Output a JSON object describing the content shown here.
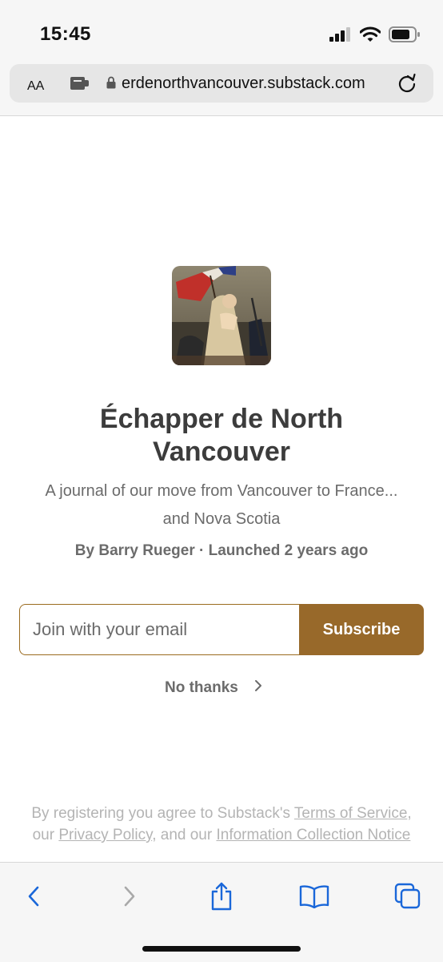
{
  "status_bar": {
    "time": "15:45",
    "icons": [
      "signal-icon",
      "wifi-icon",
      "battery-icon"
    ]
  },
  "browser": {
    "text_size_label": "AA",
    "url": "erdenorthvancouver.substack.com",
    "icons": [
      "extension-icon",
      "lock-icon",
      "reload-icon"
    ]
  },
  "publication": {
    "title": "Échapper de North Vancouver",
    "description": "A journal of our move from Vancouver to France... and Nova Scotia",
    "byline": "By Barry Rueger · Launched 2 years ago"
  },
  "signup": {
    "email_placeholder": "Join with your email",
    "subscribe_label": "Subscribe",
    "no_thanks_label": "No thanks"
  },
  "legal": {
    "prefix": "By registering you agree to Substack's",
    "terms": "Terms of Service",
    "comma": ",",
    "our": "our",
    "privacy": "Privacy Policy",
    "and_our": ", and our",
    "notice": "Information Collection Notice"
  },
  "toolbar": {
    "icons": [
      "back-icon",
      "forward-icon",
      "share-icon",
      "bookmarks-icon",
      "tabs-icon"
    ]
  },
  "colors": {
    "accent": "#98692a",
    "accent_border": "#9a6b1f",
    "toolbar_blue": "#1a67d9",
    "text_dark": "#3c3c3c",
    "text_muted": "#6b6b6b",
    "legal_text": "#b4b4b4"
  }
}
